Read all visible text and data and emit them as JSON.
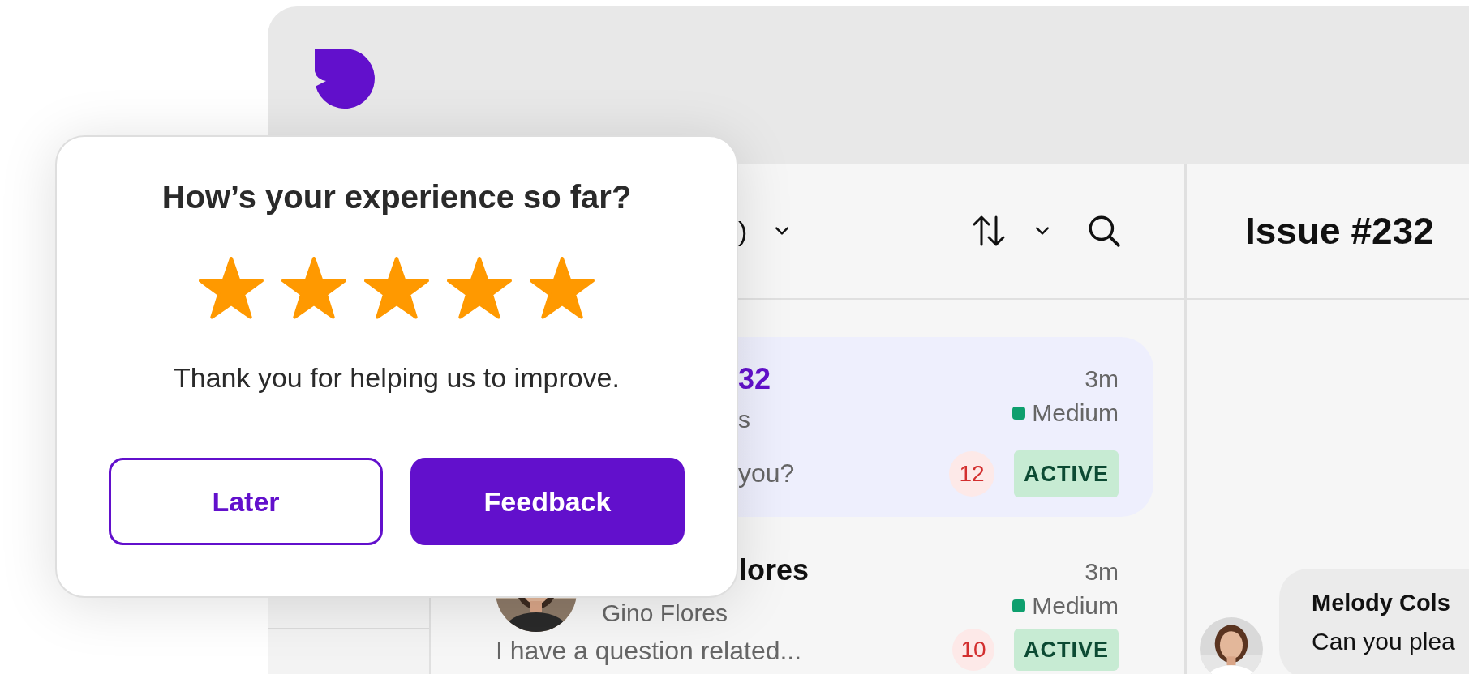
{
  "ticket_list": {
    "header": {
      "filter_label": ")"
    },
    "tickets": [
      {
        "title": "32",
        "subtitle": "s",
        "preview": "you?",
        "time": "3m",
        "priority": "Medium",
        "color": "#0e9f6e",
        "unread": "12",
        "status": "ACTIVE",
        "selected": true
      },
      {
        "title": "lores",
        "subtitle": "Gino Flores",
        "preview": "I have a question related...",
        "time": "3m",
        "priority": "Medium",
        "color": "#0e9f6e",
        "unread": "10",
        "status": "ACTIVE",
        "selected": false
      }
    ]
  },
  "issue": {
    "title": "Issue #232",
    "messages": [
      {
        "author": "Melody Cols",
        "text": "Can you plea"
      }
    ]
  },
  "survey": {
    "title": "How’s your experience so far?",
    "stars": 5,
    "message": "Thank you for helping us to improve.",
    "buttons": [
      {
        "label": "Later",
        "kind": "secondary"
      },
      {
        "label": "Feedback",
        "kind": "primary"
      }
    ]
  }
}
